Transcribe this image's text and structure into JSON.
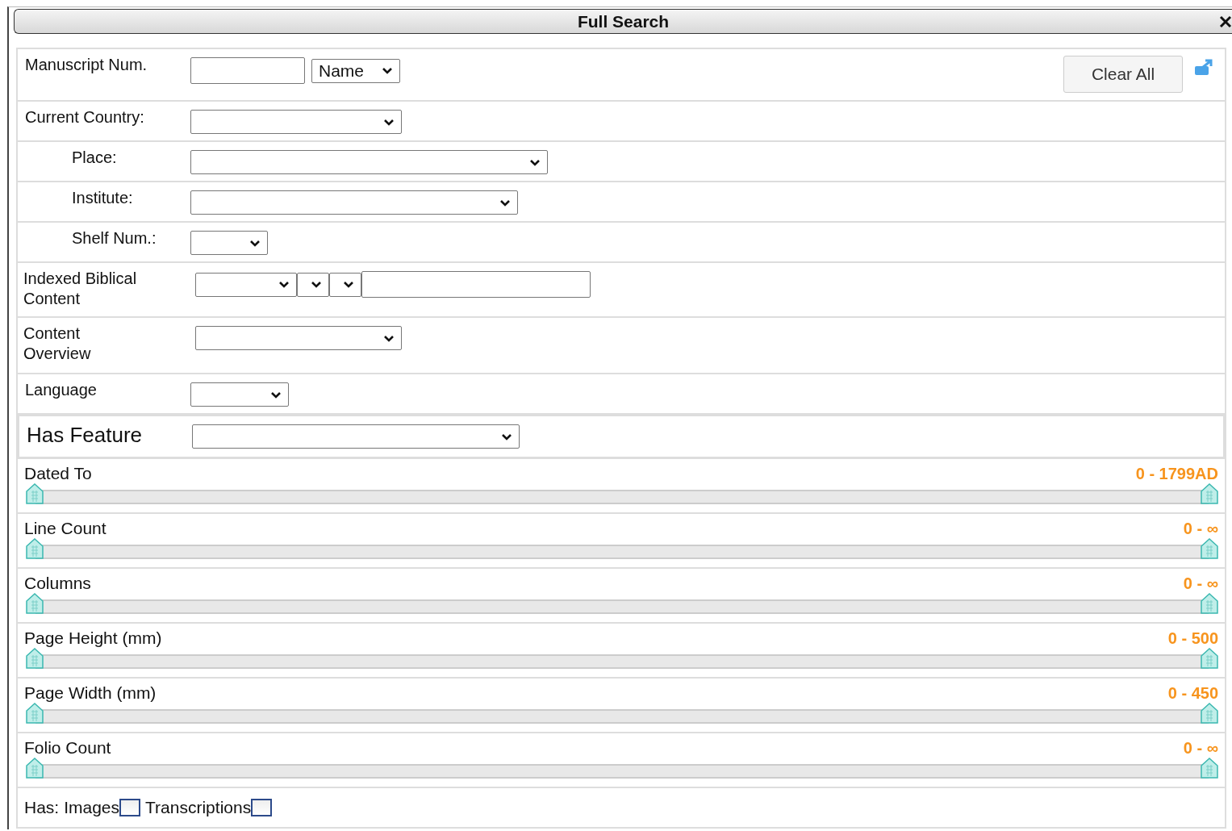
{
  "window": {
    "title": "Full Search"
  },
  "clear_button": "Clear All",
  "fields": [
    {
      "label": "Manuscript Num.",
      "kind": "plain",
      "indented": false,
      "controls": [
        {
          "kind": "input"
        },
        {
          "kind": "select",
          "value": "Name"
        }
      ]
    },
    {
      "label": "Current Country:",
      "kind": "plain",
      "indented": false,
      "controls": [
        {
          "kind": "select"
        }
      ]
    },
    {
      "label": "Place:",
      "kind": "plain",
      "indented": true,
      "controls": [
        {
          "kind": "select"
        }
      ]
    },
    {
      "label": "Institute:",
      "kind": "plain",
      "indented": true,
      "controls": [
        {
          "kind": "select"
        }
      ]
    },
    {
      "label": "Shelf Num.:",
      "kind": "plain",
      "indented": true,
      "controls": [
        {
          "kind": "select"
        }
      ]
    },
    {
      "label": "Indexed Biblical\nContent",
      "kind": "plain",
      "indented": false,
      "controls": [
        {
          "kind": "select"
        },
        {
          "kind": "select"
        },
        {
          "kind": "select"
        },
        {
          "kind": "input"
        }
      ]
    },
    {
      "label": "Content\nOverview",
      "kind": "plain",
      "indented": false,
      "controls": [
        {
          "kind": "select"
        }
      ]
    },
    {
      "label": "Language",
      "kind": "plain",
      "indented": false,
      "controls": [
        {
          "kind": "select"
        }
      ]
    },
    {
      "label": "Has Feature",
      "kind": "heading",
      "indented": false,
      "controls": [
        {
          "kind": "select"
        }
      ]
    }
  ],
  "sliders": [
    {
      "label": "Dated To",
      "reading": "0 - 1799AD",
      "level": 1
    },
    {
      "label": "Line Count",
      "reading": "0 - ∞",
      "level": 1
    },
    {
      "label": "Columns",
      "reading": "0 - ∞",
      "level": 1
    },
    {
      "label": "Page Height (mm)",
      "reading": "0 - 500",
      "level": 1
    },
    {
      "label": "Page Width (mm)",
      "reading": "0 - 450",
      "level": 1
    },
    {
      "label": "Folio Count",
      "reading": "0 - ∞",
      "level": 1
    }
  ],
  "has": {
    "label": "Has:",
    "options": [
      {
        "label": "Images",
        "checked": false
      },
      {
        "label": "Transcriptions",
        "checked": false
      }
    ]
  }
}
